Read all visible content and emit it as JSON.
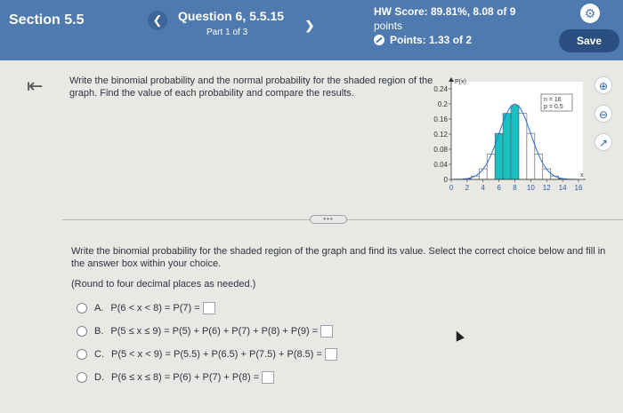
{
  "header": {
    "section": "Section 5.5",
    "question_title": "Question 6, 5.5.15",
    "part": "Part 1 of 3",
    "hw_score": "HW Score: 89.81%, 8.08 of 9",
    "hw_points_word": "points",
    "points": "Points: 1.33 of 2",
    "save": "Save"
  },
  "intro": "Write the binomial probability and the normal probability for the shaded region of the graph. Find the value of each probability and compare the results.",
  "chart_data": {
    "type": "bar",
    "ylabel": "P(x)",
    "xlabel": "x",
    "annotation_n": "n = 16",
    "annotation_p": "p = 0.5",
    "y_ticks": [
      "0.24",
      "0.2",
      "0.16",
      "0.12",
      "0.08",
      "0.04",
      "0"
    ],
    "x_ticks": [
      "0",
      "2",
      "4",
      "6",
      "8",
      "10",
      "12",
      "14",
      "16"
    ],
    "ylim": [
      0,
      0.24
    ],
    "xlim": [
      0,
      16
    ],
    "x": [
      2,
      3,
      4,
      5,
      6,
      7,
      8,
      9,
      10,
      11,
      12,
      13,
      14
    ],
    "values": [
      0.002,
      0.009,
      0.028,
      0.067,
      0.122,
      0.175,
      0.196,
      0.175,
      0.122,
      0.067,
      0.028,
      0.009,
      0.002
    ],
    "shaded_x": [
      6,
      7,
      8
    ],
    "shaded_color": "#17c1c1",
    "curve_color": "#2a6fd0"
  },
  "question": "Write the binomial probability for the shaded region of the graph and find its value. Select the correct choice below and fill in the answer box within your choice.",
  "round_note": "(Round to four decimal places as needed.)",
  "options": [
    {
      "letter": "A.",
      "text": "P(6 < x < 8) = P(7) ="
    },
    {
      "letter": "B.",
      "text": "P(5 ≤ x ≤ 9) = P(5) + P(6) + P(7) + P(8) + P(9) ="
    },
    {
      "letter": "C.",
      "text": "P(5 < x < 9) = P(5.5) + P(6.5) + P(7.5) + P(8.5) ="
    },
    {
      "letter": "D.",
      "text": "P(6 ≤ x ≤ 8) = P(6) + P(7) + P(8) ="
    }
  ],
  "icons": [
    "chevron-left-icon",
    "chevron-right-icon",
    "gear-icon",
    "points-icon",
    "back-arrow-icon",
    "zoom-in-icon",
    "zoom-out-icon",
    "popout-icon"
  ]
}
